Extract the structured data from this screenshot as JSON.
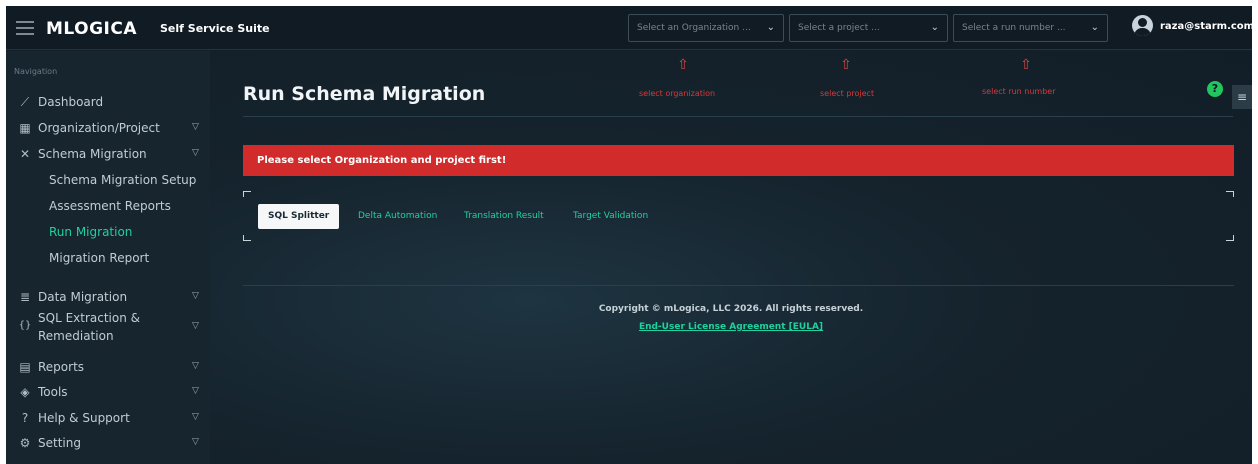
{
  "header": {
    "brand": "MLOGICA",
    "brand_sub": "Self Service Suite",
    "org_select": {
      "placeholder": "Select an Organization ..."
    },
    "project_select": {
      "placeholder": "Select a project ..."
    },
    "run_select": {
      "placeholder": "Select a run number ..."
    },
    "user": "raza@starm.com"
  },
  "sidebar": {
    "heading": "Navigation",
    "items": [
      {
        "label": "Dashboard",
        "icon": "chart-line-icon"
      },
      {
        "label": "Organization/Project",
        "icon": "grid-icon",
        "expandable": true
      },
      {
        "label": "Schema Migration",
        "icon": "tools-icon",
        "expandable": true
      },
      {
        "label": "Data Migration",
        "icon": "database-icon",
        "expandable": true
      },
      {
        "label": "SQL Extraction &",
        "label2": "Remediation",
        "icon": "braces-icon",
        "expandable": true
      },
      {
        "label": "Reports",
        "icon": "report-icon",
        "expandable": true
      },
      {
        "label": "Tools",
        "icon": "layers-icon",
        "expandable": true
      },
      {
        "label": "Help & Support",
        "icon": "help-icon",
        "expandable": true
      },
      {
        "label": "Setting",
        "icon": "gear-icon",
        "expandable": true
      }
    ],
    "schema_sub": [
      {
        "label": "Schema Migration Setup",
        "active": false
      },
      {
        "label": "Assessment Reports",
        "active": false
      },
      {
        "label": "Run Migration",
        "active": true
      },
      {
        "label": "Migration Report",
        "active": false
      }
    ]
  },
  "main": {
    "title": "Run Schema Migration",
    "hints": {
      "org": "select organization",
      "project": "select project",
      "run": "select run number"
    },
    "alert": "Please select Organization and project first!",
    "tabs": [
      {
        "label": "SQL Splitter",
        "active": true
      },
      {
        "label": "Delta Automation",
        "active": false
      },
      {
        "label": "Translation Result",
        "active": false
      },
      {
        "label": "Target Validation",
        "active": false
      }
    ],
    "copyright": "Copyright © mLogica, LLC 2026. All rights reserved.",
    "eula": "End-User License Agreement [EULA]"
  },
  "colors": {
    "accent": "#1fd19e",
    "alert": "#d22b2b",
    "annotation": "#d7393a",
    "help": "#22c55e"
  }
}
